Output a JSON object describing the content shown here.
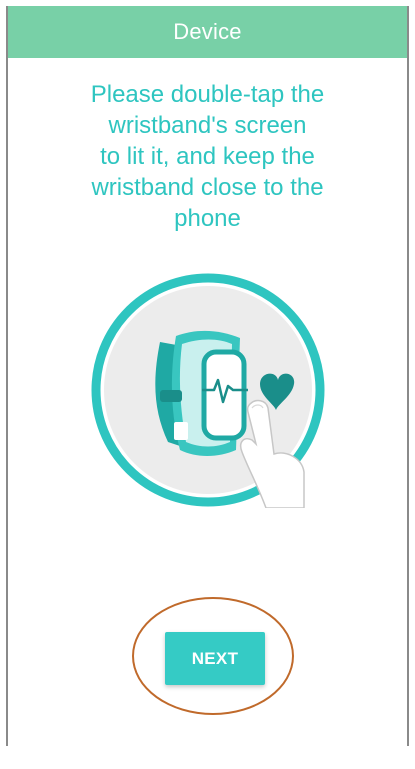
{
  "header": {
    "title": "Device"
  },
  "main": {
    "instruction": "Please double-tap the\nwristband's screen\nto lit it, and keep the\nwristband close to the\nphone",
    "next_label": "NEXT"
  },
  "colors": {
    "header_bg": "#78d0a7",
    "accent": "#35cbc5",
    "instruction_text": "#2ec5c0",
    "highlight_ring": "#c06a2b"
  },
  "icons": {
    "illustration": "wristband-tap-illustration"
  }
}
